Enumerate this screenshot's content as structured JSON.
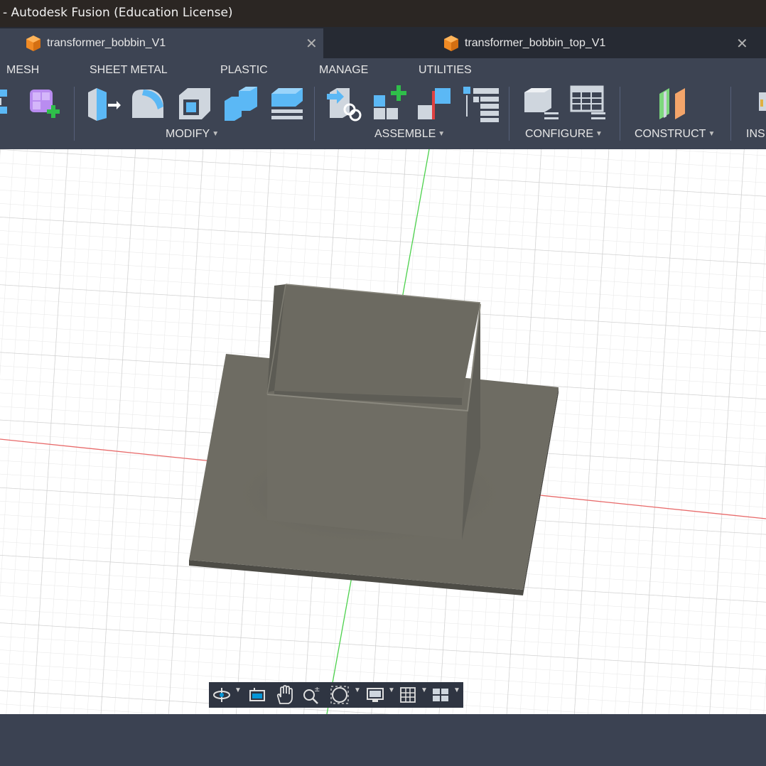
{
  "window": {
    "title": "- Autodesk Fusion (Education License)"
  },
  "tabs": [
    {
      "name": "transformer_bobbin_V1",
      "close": "✕",
      "active": true
    },
    {
      "name": "transformer_bobbin_top_V1",
      "close": "✕",
      "active": false
    }
  ],
  "menu_tabs": [
    "MESH",
    "SHEET METAL",
    "PLASTIC",
    "MANAGE",
    "UTILITIES"
  ],
  "groups": {
    "modify": "MODIFY",
    "assemble": "ASSEMBLE",
    "configure": "CONFIGURE",
    "construct": "CONSTRUCT",
    "insert": "INS"
  },
  "tools": [
    "combine-tool-icon",
    "new-component-icon",
    "press-pull-icon",
    "fillet-icon",
    "shell-icon",
    "combine-icon",
    "offset-face-icon",
    "joint-link-icon",
    "new-component-plus-icon",
    "rigid-group-icon",
    "bill-of-materials-icon",
    "configure-parameters-icon",
    "configure-table-icon",
    "offset-plane-icon",
    "insert-icon"
  ],
  "navbar": [
    "orbit-icon",
    "look-at-icon",
    "pan-icon",
    "zoom-icon",
    "fit-icon",
    "display-settings-icon",
    "grid-icon",
    "viewports-icon"
  ],
  "colors": {
    "accent": "#0696d7",
    "body": "#6e6c63",
    "grid": "#d8d8d8",
    "x_axis": "#e86a6a",
    "y_axis": "#4cd14c"
  }
}
